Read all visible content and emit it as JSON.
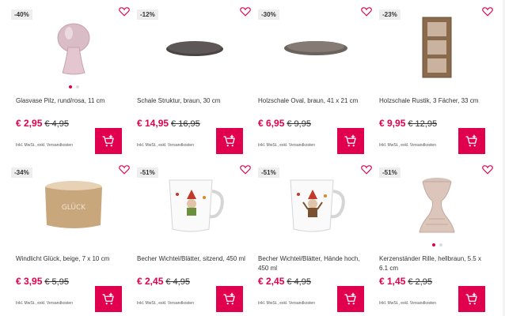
{
  "tax_note": "Inkl. MwSt., exkl. Versandkosten",
  "colors": {
    "accent": "#e0004d"
  },
  "products": [
    {
      "badge": "-40%",
      "title": "Glasvase Pilz, rund/rosa, 11 cm",
      "price": "€ 2,95",
      "old_price": "€ 4,95",
      "dots": 2,
      "active_dot": 0
    },
    {
      "badge": "-12%",
      "title": "Schale Struktur, braun, 30 cm",
      "price": "€ 14,95",
      "old_price": "€ 16,95",
      "dots": 0
    },
    {
      "badge": "-30%",
      "title": "Holzschale Oval, braun, 41 x 21 cm",
      "price": "€ 6,95",
      "old_price": "€ 9,95",
      "dots": 0
    },
    {
      "badge": "-23%",
      "title": "Holzschale Rustik, 3 Fächer, 33 cm",
      "price": "€ 9,95",
      "old_price": "€ 12,95",
      "dots": 0
    },
    {
      "badge": "-34%",
      "title": "Windlicht Glück, beige, 7 x 10 cm",
      "price": "€ 3,95",
      "old_price": "€ 5,95",
      "dots": 0
    },
    {
      "badge": "-51%",
      "title": "Becher Wichtel/Blätter, sitzend, 450 ml",
      "price": "€ 2,45",
      "old_price": "€ 4,95",
      "dots": 0
    },
    {
      "badge": "-51%",
      "title": "Becher Wichtel/Blätter, Hände hoch, 450 ml",
      "price": "€ 2,45",
      "old_price": "€ 4,95",
      "dots": 0
    },
    {
      "badge": "-51%",
      "title": "Kerzenständer Rille, hellbraun, 5.5 x 6.1 cm",
      "price": "€ 1,45",
      "old_price": "€ 2,95",
      "dots": 2,
      "active_dot": 0
    }
  ],
  "product_images": [
    "pink-mushroom-vase",
    "dark-round-tray",
    "oval-wooden-bowl",
    "rustic-shelf",
    "glueck-candle-holder",
    "gnome-mug-sitting",
    "gnome-mug-hands-up",
    "ribbed-candle-holder"
  ]
}
